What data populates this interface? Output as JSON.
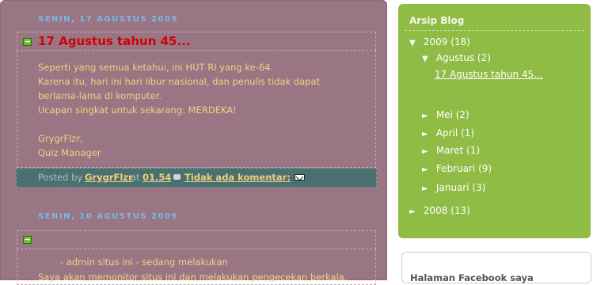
{
  "posts": [
    {
      "date": "SENIN, 17 AGUSTUS 2009",
      "title": "17 Agustus tahun 45...",
      "body": [
        "Seperti yang semua ketahui, ini HUT RI yang ke-64.",
        "Karena itu, hari ini hari libur nasional, dan penulis tidak dapat",
        "berlama-lama di komputer.",
        "Ucapan singkat untuk sekarang: MERDEKA!",
        "",
        "GrygrFlzr,",
        "Quiz Manager"
      ],
      "footer": {
        "posted_by": "Posted by",
        "author": "GrygrFlzr",
        "at": "at",
        "time": "01.54",
        "comments": "Tidak ada komentar:"
      }
    },
    {
      "date": "SENIN, 10 AGUSTUS 2009",
      "title": "",
      "body": [
        "- admin situs ini - sedang melakukan",
        "Saya akan memonitor situs ini dan melakukan pengecekan berkala."
      ]
    }
  ],
  "sidebar": {
    "archive_title": "Arsip Blog",
    "tree": {
      "y2009": {
        "toggle": "▼",
        "label": "2009",
        "count": "(18)"
      },
      "agustus": {
        "toggle": "▼",
        "label": "Agustus",
        "count": "(2)"
      },
      "agustus_post": "17 Agustus tahun 45...",
      "mei": {
        "toggle": "►",
        "label": "Mei",
        "count": "(2)"
      },
      "april": {
        "toggle": "►",
        "label": "April",
        "count": "(1)"
      },
      "maret": {
        "toggle": "►",
        "label": "Maret",
        "count": "(1)"
      },
      "februari": {
        "toggle": "►",
        "label": "Februari",
        "count": "(9)"
      },
      "januari": {
        "toggle": "►",
        "label": "Januari",
        "count": "(3)"
      },
      "y2008": {
        "toggle": "►",
        "label": "2008",
        "count": "(13)"
      }
    },
    "facebook_title": "Halaman Facebook saya"
  },
  "colors": {
    "main_bg": "#9a7685",
    "title_red": "#d00000",
    "body_text": "#f0d080",
    "date_blue": "#79b8e8",
    "sidebar_green": "#8fbc45",
    "footer_teal": "#4a7070"
  },
  "icons": [
    "arrow-right-icon",
    "comment-icon",
    "email-icon"
  ]
}
